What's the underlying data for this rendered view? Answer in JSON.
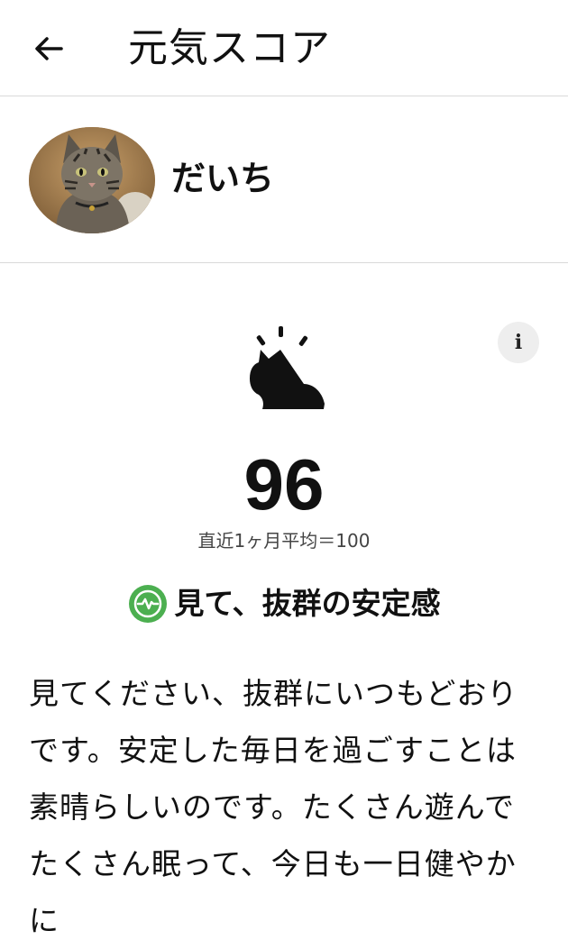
{
  "header": {
    "title": "元気スコア"
  },
  "profile": {
    "name": "だいち"
  },
  "score": {
    "value": "96",
    "average_label": "直近1ヶ月平均＝100",
    "status_label": "見て、抜群の安定感",
    "status_color": "#4caf50",
    "icon": "cat-sitting-icon"
  },
  "message": {
    "text": "見てください、抜群にいつもどおりです。安定した毎日を過ごすことは素晴らしいのです。たくさん遊んでたくさん眠って、今日も一日健やかに"
  }
}
